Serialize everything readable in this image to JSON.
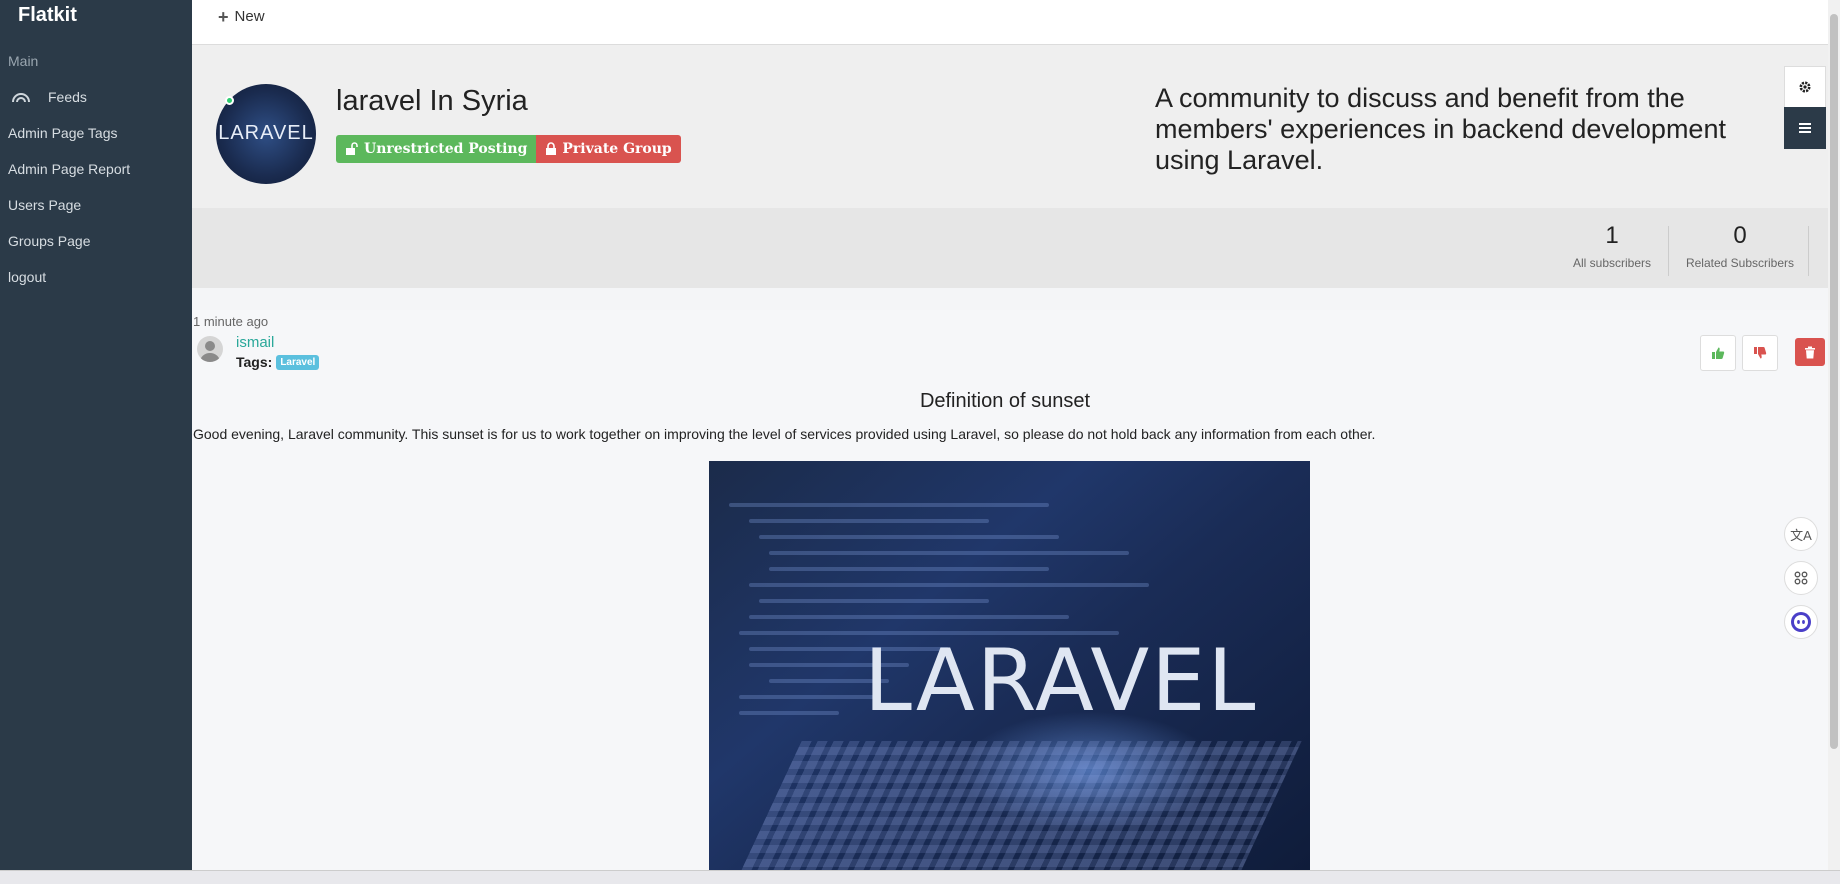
{
  "sidebar": {
    "brand": "Flatkit",
    "section": "Main",
    "items": [
      {
        "label": "Feeds",
        "icon": "feeds-icon"
      },
      {
        "label": "Admin Page Tags"
      },
      {
        "label": "Admin Page Report"
      },
      {
        "label": "Users Page"
      },
      {
        "label": "Groups Page"
      },
      {
        "label": "logout"
      }
    ]
  },
  "topbar": {
    "new_label": "New"
  },
  "group": {
    "title": "laravel In Syria",
    "avatar_text": "LARAVEL",
    "badge_posting": "Unrestricted Posting",
    "badge_privacy": "Private Group",
    "description": "A community to discuss and benefit from the members' experiences in backend development using Laravel."
  },
  "stats": {
    "all_subscribers": {
      "value": "1",
      "label": "All subscribers"
    },
    "related_subscribers": {
      "value": "0",
      "label": "Related Subscribers"
    }
  },
  "post": {
    "time": "1 minute ago",
    "author": "ismail",
    "tags_label": "Tags:",
    "tag": "Laravel",
    "title": "Definition of sunset",
    "body": "Good evening, Laravel community. This sunset is for us to work together on improving the level of services provided using Laravel, so please do not hold back any information from each other.",
    "image_text": "LARAVEL"
  },
  "colors": {
    "sidebar": "#2b3a48",
    "success": "#5cb85c",
    "danger": "#d9534f",
    "info": "#5bc0de",
    "link": "#2aa89a"
  }
}
